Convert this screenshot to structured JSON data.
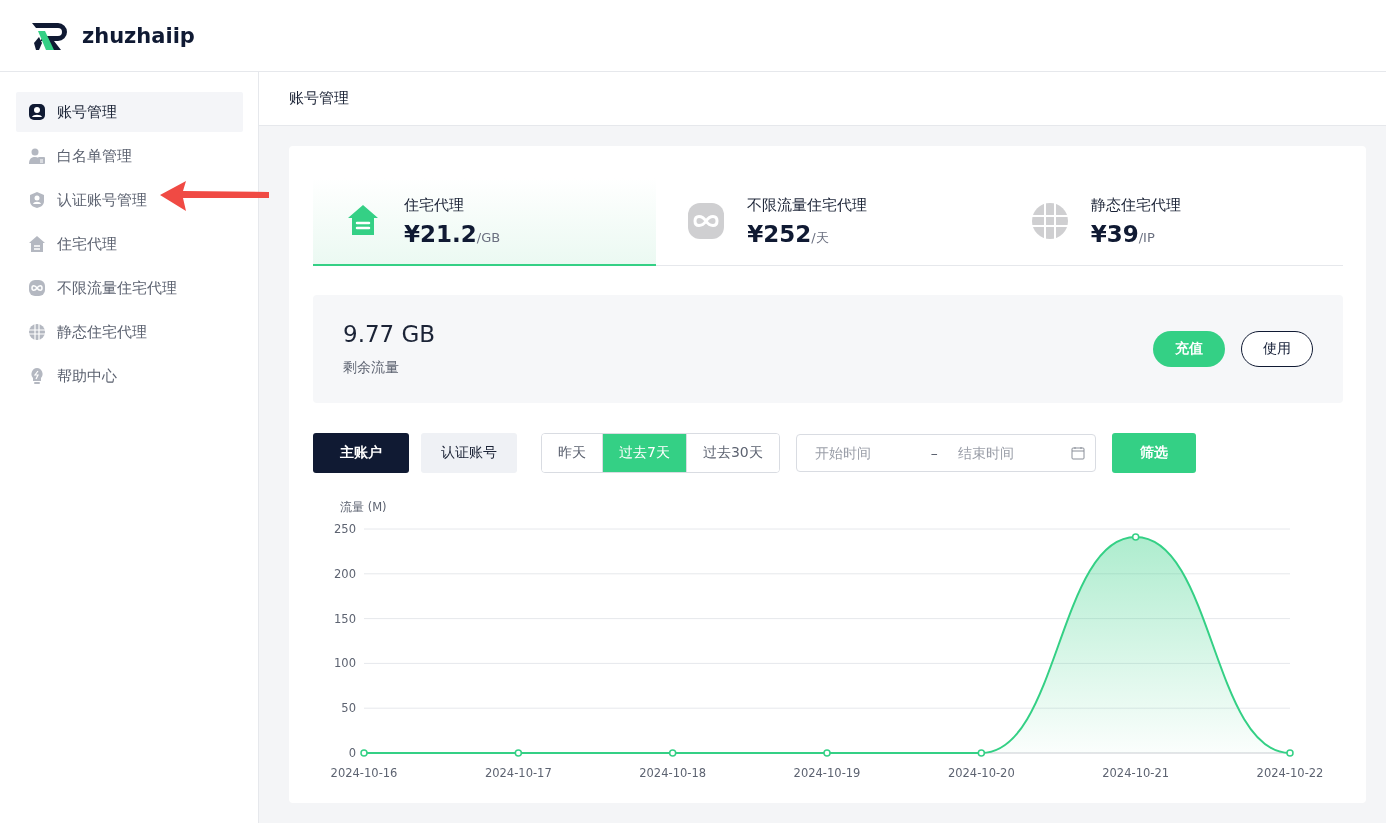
{
  "brand": {
    "name": "zhuzhaiip"
  },
  "sidebar": {
    "items": [
      {
        "label": "账号管理",
        "selected": true
      },
      {
        "label": "白名单管理",
        "selected": false
      },
      {
        "label": "认证账号管理",
        "selected": false
      },
      {
        "label": "住宅代理",
        "selected": false
      },
      {
        "label": "不限流量住宅代理",
        "selected": false
      },
      {
        "label": "静态住宅代理",
        "selected": false
      },
      {
        "label": "帮助中心",
        "selected": false
      }
    ]
  },
  "page_title": "账号管理",
  "products": [
    {
      "name": "住宅代理",
      "price": "¥21.2",
      "unit": "/GB",
      "selected": true
    },
    {
      "name": "不限流量住宅代理",
      "price": "¥252",
      "unit": "/天",
      "selected": false
    },
    {
      "name": "静态住宅代理",
      "price": "¥39",
      "unit": "/IP",
      "selected": false
    }
  ],
  "balance": {
    "value": "9.77 GB",
    "label": "剩余流量",
    "buttons": [
      {
        "label": "充值",
        "kind": "primary"
      },
      {
        "label": "使用",
        "kind": "outline"
      }
    ]
  },
  "account_tabs": [
    {
      "label": "主账户",
      "selected": true
    },
    {
      "label": "认证账号",
      "selected": false
    }
  ],
  "ranges": [
    {
      "label": "昨天",
      "selected": false
    },
    {
      "label": "过去7天",
      "selected": true
    },
    {
      "label": "过去30天",
      "selected": false
    }
  ],
  "date_range": {
    "start_placeholder": "开始时间",
    "separator": "–",
    "end_placeholder": "结束时间"
  },
  "filter_button": "筛选",
  "chart_data": {
    "type": "area",
    "ylabel": "流量 (M)",
    "categories": [
      "2024-10-16",
      "2024-10-17",
      "2024-10-18",
      "2024-10-19",
      "2024-10-20",
      "2024-10-21",
      "2024-10-22"
    ],
    "series": [
      {
        "color": "#34d085",
        "values": [
          0,
          0,
          0,
          0,
          0,
          241,
          0
        ]
      }
    ],
    "ylim": [
      0,
      250
    ],
    "yticks": [
      0,
      50,
      100,
      150,
      200,
      250
    ],
    "grid": true
  }
}
